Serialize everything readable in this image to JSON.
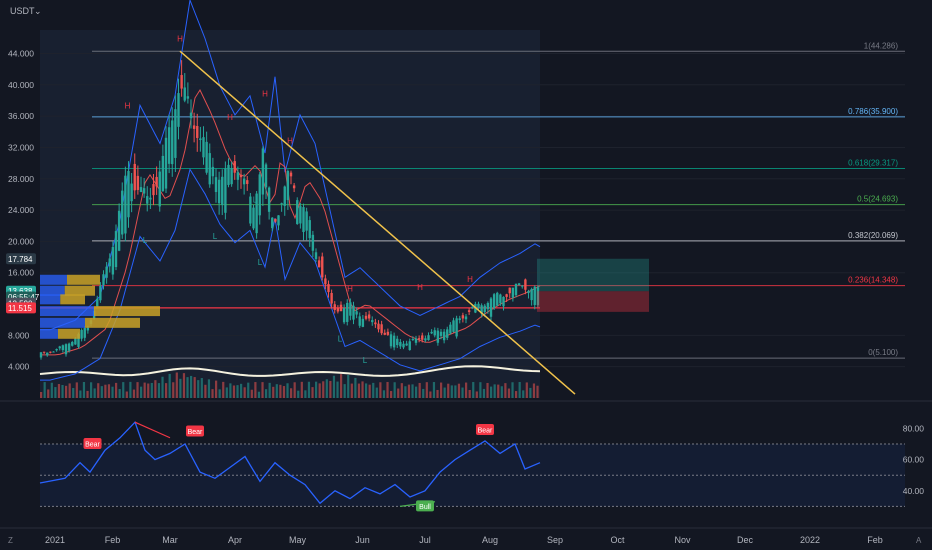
{
  "header": {
    "currency": "USDT",
    "settings_glyph": "⌄"
  },
  "price_axis": {
    "ticks": [
      {
        "label": "44.000",
        "value": 44
      },
      {
        "label": "40.000",
        "value": 40
      },
      {
        "label": "36.000",
        "value": 36
      },
      {
        "label": "32.000",
        "value": 32
      },
      {
        "label": "28.000",
        "value": 28
      },
      {
        "label": "24.000",
        "value": 24
      },
      {
        "label": "20.000",
        "value": 20
      },
      {
        "label": "16.000",
        "value": 16
      },
      {
        "label": "8.000",
        "value": 8
      },
      {
        "label": "4.000",
        "value": 4
      }
    ],
    "badges": [
      {
        "text": "17.784",
        "value": 17.784,
        "color": "#2b3a46"
      },
      {
        "text": "13.638",
        "value": 13.638,
        "color": "#26a69a"
      },
      {
        "text": "06:55:47",
        "value": 12.9,
        "color": "#1e5f59"
      },
      {
        "text": "13.590",
        "value": 12.1,
        "color": "#4a4f5c"
      },
      {
        "text": "11.515",
        "value": 11.515,
        "color": "#f23645"
      }
    ]
  },
  "fib_levels": [
    {
      "label": "1(44.286)",
      "value": 44.286,
      "color": "#787b86"
    },
    {
      "label": "0.786(35.900)",
      "value": 35.9,
      "color": "#64b5f6"
    },
    {
      "label": "0.618(29.317)",
      "value": 29.317,
      "color": "#089981"
    },
    {
      "label": "0.5(24.693)",
      "value": 24.693,
      "color": "#4caf50"
    },
    {
      "label": "0.382(20.069)",
      "value": 20.069,
      "color": "#c4c7cf"
    },
    {
      "label": "0.236(14.348)",
      "value": 14.348,
      "color": "#f23645"
    },
    {
      "label": "0(5.100)",
      "value": 5.1,
      "color": "#787b86"
    }
  ],
  "pivot_markers": [
    {
      "text": "H",
      "x": 0.175,
      "y": 37.0,
      "color": "#f23645"
    },
    {
      "text": "H",
      "x": 0.28,
      "y": 45.5,
      "color": "#f23645"
    },
    {
      "text": "H",
      "x": 0.38,
      "y": 35.5,
      "color": "#f23645"
    },
    {
      "text": "H",
      "x": 0.45,
      "y": 38.5,
      "color": "#f23645"
    },
    {
      "text": "H",
      "x": 0.5,
      "y": 32.5,
      "color": "#f23645"
    },
    {
      "text": "H",
      "x": 0.62,
      "y": 13.6,
      "color": "#f23645"
    },
    {
      "text": "H",
      "x": 0.76,
      "y": 13.8,
      "color": "#f23645"
    },
    {
      "text": "H",
      "x": 0.86,
      "y": 14.8,
      "color": "#f23645"
    },
    {
      "text": "L",
      "x": 0.21,
      "y": 19.8,
      "color": "#26a69a"
    },
    {
      "text": "L",
      "x": 0.35,
      "y": 20.3,
      "color": "#26a69a"
    },
    {
      "text": "L",
      "x": 0.43,
      "y": 25.0,
      "color": "#26a69a"
    },
    {
      "text": "L",
      "x": 0.44,
      "y": 17.0,
      "color": "#26a69a"
    },
    {
      "text": "L",
      "x": 0.6,
      "y": 7.2,
      "color": "#26a69a"
    },
    {
      "text": "L",
      "x": 0.65,
      "y": 4.5,
      "color": "#26a69a"
    }
  ],
  "trendline": {
    "from": {
      "x": 0.28,
      "y": 44.3
    },
    "to": {
      "x": 1.07,
      "y": 0.5
    },
    "color": "#f0c24b"
  },
  "rsi": {
    "axis": [
      {
        "label": "80.00",
        "value": 80
      },
      {
        "label": "60.00",
        "value": 60
      },
      {
        "label": "40.00",
        "value": 40
      }
    ],
    "band_upper": 70,
    "band_mid": 50,
    "band_lower": 30,
    "labels": [
      {
        "text": "Bear",
        "x": 0.105,
        "y": 70,
        "kind": "bear"
      },
      {
        "text": "Bear",
        "x": 0.31,
        "y": 78,
        "kind": "bear"
      },
      {
        "text": "Bear",
        "x": 0.89,
        "y": 79,
        "kind": "bear"
      },
      {
        "text": "Bull",
        "x": 0.77,
        "y": 30,
        "kind": "bull"
      }
    ]
  },
  "time_axis": {
    "labels": [
      {
        "text": "2021",
        "x": 0.0
      },
      {
        "text": "Feb",
        "x": 0.115
      },
      {
        "text": "Mar",
        "x": 0.23
      },
      {
        "text": "Apr",
        "x": 0.36
      },
      {
        "text": "May",
        "x": 0.485
      },
      {
        "text": "Jun",
        "x": 0.615
      },
      {
        "text": "Jul",
        "x": 0.74
      },
      {
        "text": "Aug",
        "x": 0.87
      },
      {
        "text": "Sep",
        "x": 1.0
      },
      {
        "text": "Oct",
        "x": 1.125
      },
      {
        "text": "Nov",
        "x": 1.255
      },
      {
        "text": "Dec",
        "x": 1.38
      },
      {
        "text": "2022",
        "x": 1.51
      },
      {
        "text": "Feb",
        "x": 1.64
      }
    ],
    "corner_left": "Z",
    "corner_right": "A"
  },
  "colors": {
    "bg": "#131722",
    "up": "#26a69a",
    "down": "#ef5350",
    "grid": "#1e222d",
    "text": "#b2b5be",
    "bb": "#2962ff",
    "ma": "#e04f4f",
    "vol_avg": "#f5f2df",
    "rsi_line": "#2962ff",
    "volume_profile": "#c9a227"
  },
  "chart_data": {
    "type": "candlestick",
    "title": "",
    "ylim": [
      0,
      47
    ],
    "x": [
      "2021-01",
      "2021-02",
      "2021-03",
      "2021-04",
      "2021-05",
      "2021-06",
      "2021-07",
      "2021-08"
    ],
    "close_trend": [
      {
        "x": 0.0,
        "y": 5.5
      },
      {
        "x": 0.05,
        "y": 6.5
      },
      {
        "x": 0.1,
        "y": 9
      },
      {
        "x": 0.14,
        "y": 17
      },
      {
        "x": 0.18,
        "y": 29
      },
      {
        "x": 0.22,
        "y": 25
      },
      {
        "x": 0.25,
        "y": 30
      },
      {
        "x": 0.28,
        "y": 40
      },
      {
        "x": 0.31,
        "y": 36
      },
      {
        "x": 0.34,
        "y": 31
      },
      {
        "x": 0.37,
        "y": 28
      },
      {
        "x": 0.4,
        "y": 30
      },
      {
        "x": 0.43,
        "y": 24
      },
      {
        "x": 0.45,
        "y": 32
      },
      {
        "x": 0.47,
        "y": 22
      },
      {
        "x": 0.5,
        "y": 28
      },
      {
        "x": 0.53,
        "y": 25
      },
      {
        "x": 0.56,
        "y": 18
      },
      {
        "x": 0.59,
        "y": 11
      },
      {
        "x": 0.62,
        "y": 12
      },
      {
        "x": 0.66,
        "y": 10
      },
      {
        "x": 0.7,
        "y": 8
      },
      {
        "x": 0.74,
        "y": 7
      },
      {
        "x": 0.78,
        "y": 8
      },
      {
        "x": 0.82,
        "y": 9
      },
      {
        "x": 0.86,
        "y": 11
      },
      {
        "x": 0.9,
        "y": 12.5
      },
      {
        "x": 0.94,
        "y": 13.5
      },
      {
        "x": 0.97,
        "y": 14.5
      },
      {
        "x": 1.0,
        "y": 13.6
      }
    ],
    "rsi_series": [
      {
        "x": 0.0,
        "y": 45
      },
      {
        "x": 0.05,
        "y": 48
      },
      {
        "x": 0.08,
        "y": 58
      },
      {
        "x": 0.1,
        "y": 52
      },
      {
        "x": 0.13,
        "y": 66
      },
      {
        "x": 0.16,
        "y": 74
      },
      {
        "x": 0.19,
        "y": 84
      },
      {
        "x": 0.21,
        "y": 66
      },
      {
        "x": 0.23,
        "y": 60
      },
      {
        "x": 0.26,
        "y": 64
      },
      {
        "x": 0.29,
        "y": 70
      },
      {
        "x": 0.32,
        "y": 52
      },
      {
        "x": 0.35,
        "y": 48
      },
      {
        "x": 0.38,
        "y": 55
      },
      {
        "x": 0.41,
        "y": 62
      },
      {
        "x": 0.44,
        "y": 46
      },
      {
        "x": 0.47,
        "y": 58
      },
      {
        "x": 0.5,
        "y": 50
      },
      {
        "x": 0.53,
        "y": 44
      },
      {
        "x": 0.56,
        "y": 32
      },
      {
        "x": 0.59,
        "y": 40
      },
      {
        "x": 0.62,
        "y": 35
      },
      {
        "x": 0.65,
        "y": 42
      },
      {
        "x": 0.68,
        "y": 38
      },
      {
        "x": 0.71,
        "y": 44
      },
      {
        "x": 0.74,
        "y": 36
      },
      {
        "x": 0.77,
        "y": 40
      },
      {
        "x": 0.8,
        "y": 52
      },
      {
        "x": 0.83,
        "y": 60
      },
      {
        "x": 0.86,
        "y": 66
      },
      {
        "x": 0.89,
        "y": 72
      },
      {
        "x": 0.92,
        "y": 64
      },
      {
        "x": 0.95,
        "y": 70
      },
      {
        "x": 0.97,
        "y": 54
      },
      {
        "x": 1.0,
        "y": 58
      }
    ]
  }
}
